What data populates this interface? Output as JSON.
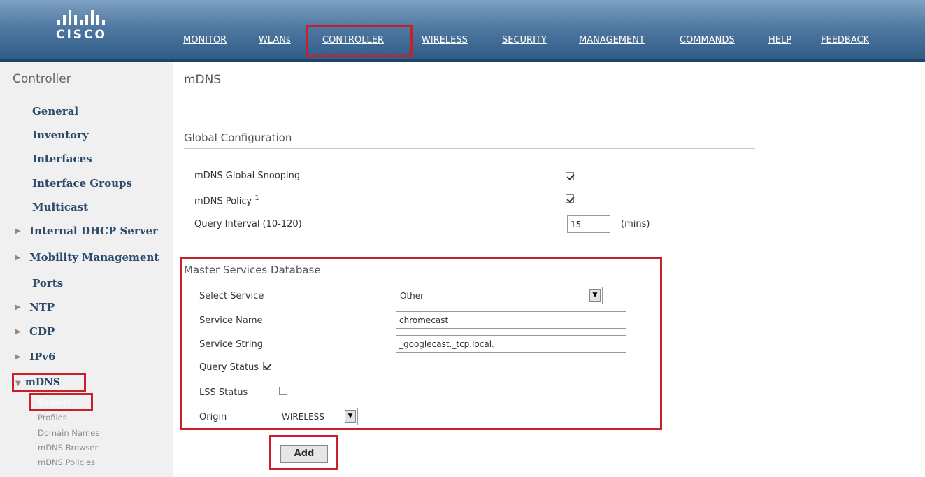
{
  "brand": {
    "logo_text": "cisco"
  },
  "nav": [
    {
      "label": "MONITOR"
    },
    {
      "label": "WLANs"
    },
    {
      "label": "CONTROLLER"
    },
    {
      "label": "WIRELESS"
    },
    {
      "label": "SECURITY"
    },
    {
      "label": "MANAGEMENT"
    },
    {
      "label": "COMMANDS"
    },
    {
      "label": "HELP"
    },
    {
      "label": "FEEDBACK"
    }
  ],
  "sidebar": {
    "title": "Controller",
    "items": [
      {
        "label": "General"
      },
      {
        "label": "Inventory"
      },
      {
        "label": "Interfaces"
      },
      {
        "label": "Interface Groups"
      },
      {
        "label": "Multicast"
      },
      {
        "label": "Internal DHCP Server"
      },
      {
        "label": "Mobility Management"
      },
      {
        "label": "Ports"
      },
      {
        "label": "NTP"
      },
      {
        "label": "CDP"
      },
      {
        "label": "IPv6"
      },
      {
        "label": "mDNS"
      }
    ],
    "mdns_subitems": [
      {
        "label": "General"
      },
      {
        "label": "Profiles"
      },
      {
        "label": "Domain Names"
      },
      {
        "label": "mDNS Browser"
      },
      {
        "label": "mDNS Policies"
      }
    ]
  },
  "main": {
    "page_title": "mDNS",
    "global": {
      "heading": "Global Configuration",
      "snooping_label": "mDNS Global Snooping",
      "snooping_checked": true,
      "policy_label": "mDNS Policy",
      "policy_footnote": "1",
      "policy_checked": true,
      "query_interval_label": "Query Interval (10-120)",
      "query_interval_value": "15",
      "query_interval_unit": "(mins)"
    },
    "msd": {
      "heading": "Master Services Database",
      "select_service_label": "Select Service",
      "select_service_value": "Other",
      "service_name_label": "Service Name",
      "service_name_value": "chromecast",
      "service_string_label": "Service String",
      "service_string_value": "_googlecast._tcp.local.",
      "query_status_label": "Query Status",
      "query_status_checked": true,
      "lss_status_label": "LSS Status",
      "lss_status_checked": false,
      "origin_label": "Origin",
      "origin_value": "WIRELESS"
    },
    "add_button": "Add"
  },
  "colors": {
    "highlight": "#c8202b",
    "header": "#4f78a1",
    "sidebar_link": "#2c4a6b"
  }
}
